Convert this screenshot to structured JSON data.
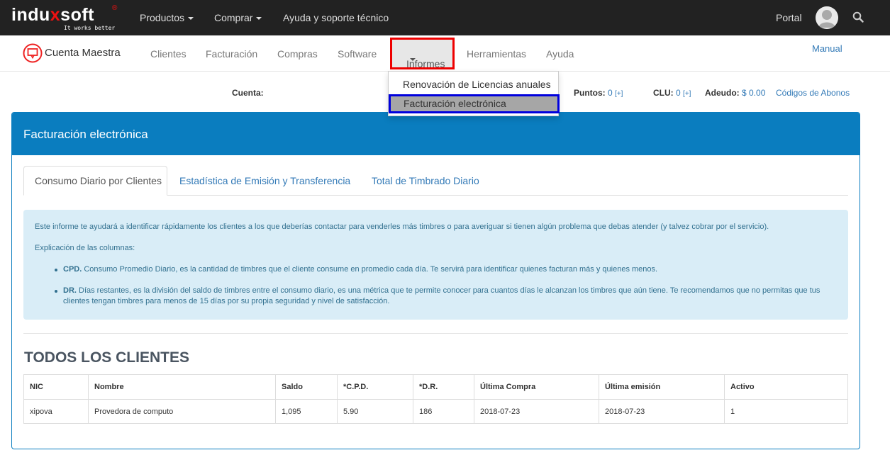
{
  "brand": {
    "name_part1": "indu",
    "name_x": "x",
    "name_part2": "soft",
    "reg": "®",
    "slogan": "It works better"
  },
  "topnav": {
    "productos": "Productos",
    "comprar": "Comprar",
    "ayuda": "Ayuda y soporte técnico",
    "portal": "Portal"
  },
  "secondnav": {
    "title": "Cuenta Maestra",
    "items": [
      "Clientes",
      "Facturación",
      "Compras",
      "Software",
      "Informes",
      "Herramientas",
      "Ayuda"
    ],
    "manual": "Manual"
  },
  "dropdown": {
    "item1": "Renovación de Licencias anuales",
    "item2": "Facturación electrónica"
  },
  "account": {
    "cuenta_label": "Cuenta:",
    "puntos_label": "Puntos:",
    "puntos_value": "0",
    "clu_label": "CLU:",
    "clu_value": "0",
    "plus": "[+]",
    "adeudo_label": "Adeudo:",
    "adeudo_value": "$ 0.00",
    "codigos": "Códigos de Abonos"
  },
  "panel": {
    "title": "Facturación electrónica",
    "tabs": [
      "Consumo Diario por Clientes",
      "Estadística de Emisión y Transferencia",
      "Total de Timbrado Diario"
    ],
    "info": {
      "intro": "Este informe te ayudará a identificar rápidamente los clientes a los que deberías contactar para venderles más timbres o para averiguar si tienen algún problema que debas atender (y talvez cobrar por el servicio).",
      "explain": "Explicación de las columnas:",
      "cpd_term": "CPD.",
      "cpd_text": " Consumo Promedio Diario, es la cantidad de timbres que el cliente consume en promedio cada día. Te servirá para identificar quienes facturan más y quienes menos.",
      "dr_term": "DR.",
      "dr_text": " Días restantes, es la división del saldo de timbres entre el consumo diario, es una métrica que te permite conocer para cuantos días le alcanzan los timbres que aún tiene. Te recomendamos que no permitas que tus clientes tengan timbres para menos de 15 días por su propia seguridad y nivel de satisfacción."
    },
    "section_title": "TODOS LOS CLIENTES",
    "table": {
      "headers": [
        "NIC",
        "Nombre",
        "Saldo",
        "*C.P.D.",
        "*D.R.",
        "Última Compra",
        "Última emisión",
        "Activo"
      ],
      "rows": [
        [
          "xipova",
          "Provedora de computo",
          "1,095",
          "5.90",
          "186",
          "2018-07-23",
          "2018-07-23",
          "1"
        ]
      ]
    }
  },
  "colors": {
    "panel_blue": "#0a7dbf",
    "info_bg": "#d9edf7",
    "highlight_red": "#ee0000",
    "highlight_blue": "#0000dd"
  }
}
